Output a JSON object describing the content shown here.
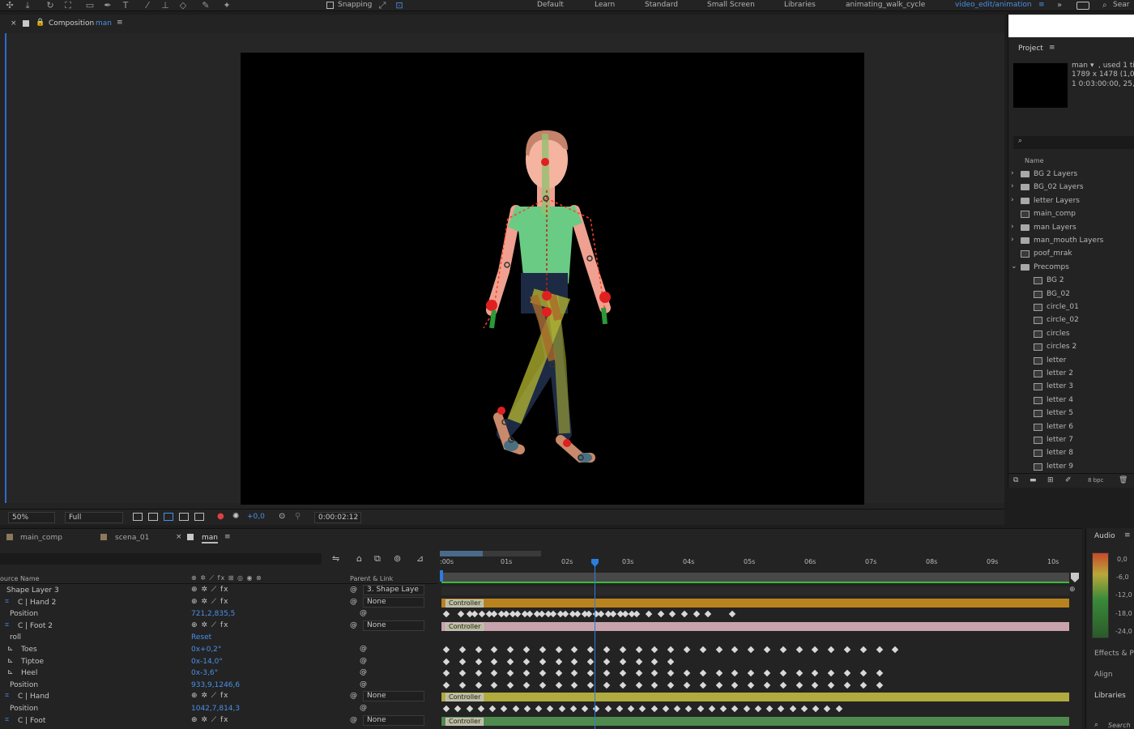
{
  "toolbar": {
    "snapping": "Snapping",
    "workspaces": [
      "Default",
      "Learn",
      "Standard",
      "Small Screen",
      "Libraries",
      "animating_walk_cycle"
    ],
    "active_workspace": "video_edit/animation",
    "search": "Sear"
  },
  "composition": {
    "panel_title": "Composition",
    "comp_name": "man",
    "breadcrumbs": [
      "main_comp",
      "scena_01",
      "man"
    ],
    "zoom": "50%",
    "resolution": "Full",
    "exposure": "+0,0",
    "timecode": "0:00:02:12"
  },
  "project": {
    "title": "Project",
    "thumb_name": "man",
    "thumb_used": ", used 1 ti",
    "thumb_dims": "1789 x 1478 (1,00)",
    "thumb_dur": "1 0:03:00:00, 25,00",
    "col_name": "Name",
    "bpc": "8 bpc",
    "items": [
      {
        "name": "BG 2 Layers",
        "type": "folder",
        "indent": 0,
        "expand": "›"
      },
      {
        "name": "BG_02 Layers",
        "type": "folder",
        "indent": 0,
        "expand": "›"
      },
      {
        "name": "letter Layers",
        "type": "folder",
        "indent": 0,
        "expand": "›"
      },
      {
        "name": "main_comp",
        "type": "comp",
        "indent": 0,
        "expand": ""
      },
      {
        "name": "man Layers",
        "type": "folder",
        "indent": 0,
        "expand": "›"
      },
      {
        "name": "man_mouth Layers",
        "type": "folder",
        "indent": 0,
        "expand": "›"
      },
      {
        "name": "poof_mrak",
        "type": "comp",
        "indent": 0,
        "expand": ""
      },
      {
        "name": "Precomps",
        "type": "folder",
        "indent": 0,
        "expand": "⌄"
      },
      {
        "name": "BG 2",
        "type": "comp",
        "indent": 1,
        "expand": ""
      },
      {
        "name": "BG_02",
        "type": "comp",
        "indent": 1,
        "expand": ""
      },
      {
        "name": "circle_01",
        "type": "comp",
        "indent": 1,
        "expand": ""
      },
      {
        "name": "circle_02",
        "type": "comp",
        "indent": 1,
        "expand": ""
      },
      {
        "name": "circles",
        "type": "comp",
        "indent": 1,
        "expand": ""
      },
      {
        "name": "circles 2",
        "type": "comp",
        "indent": 1,
        "expand": ""
      },
      {
        "name": "letter",
        "type": "comp",
        "indent": 1,
        "expand": ""
      },
      {
        "name": "letter 2",
        "type": "comp",
        "indent": 1,
        "expand": ""
      },
      {
        "name": "letter 3",
        "type": "comp",
        "indent": 1,
        "expand": ""
      },
      {
        "name": "letter 4",
        "type": "comp",
        "indent": 1,
        "expand": ""
      },
      {
        "name": "letter 5",
        "type": "comp",
        "indent": 1,
        "expand": ""
      },
      {
        "name": "letter 6",
        "type": "comp",
        "indent": 1,
        "expand": ""
      },
      {
        "name": "letter 7",
        "type": "comp",
        "indent": 1,
        "expand": ""
      },
      {
        "name": "letter 8",
        "type": "comp",
        "indent": 1,
        "expand": ""
      },
      {
        "name": "letter 9",
        "type": "comp",
        "indent": 1,
        "expand": ""
      }
    ]
  },
  "timeline": {
    "tabs": [
      "main_comp",
      "scena_01",
      "man"
    ],
    "col_source": "ource Name",
    "col_parent": "Parent & Link",
    "ruler": [
      ":00s",
      "01s",
      "02s",
      "03s",
      "04s",
      "05s",
      "06s",
      "07s",
      "08s",
      "09s",
      "10s"
    ],
    "controller_label": "Controller",
    "layers": [
      {
        "name": "Shape Layer 3",
        "value": "",
        "parent": "3. Shape Laye",
        "kind": "layer",
        "icon": false
      },
      {
        "name": "C | Hand 2",
        "value": "",
        "parent": "None",
        "kind": "layer",
        "icon": true
      },
      {
        "name": "Position",
        "value": "721,2,835,5",
        "parent": "",
        "kind": "prop",
        "icon": false
      },
      {
        "name": "C | Foot 2",
        "value": "",
        "parent": "None",
        "kind": "layer",
        "icon": true
      },
      {
        "name": "roll",
        "value": "Reset",
        "parent": "",
        "kind": "prop",
        "icon": false
      },
      {
        "name": "Toes",
        "value": "0x+0,2°",
        "parent": "",
        "kind": "sub",
        "icon": false
      },
      {
        "name": "Tiptoe",
        "value": "0x-14,0°",
        "parent": "",
        "kind": "sub",
        "icon": false
      },
      {
        "name": "Heel",
        "value": "0x-3,6°",
        "parent": "",
        "kind": "sub",
        "icon": false
      },
      {
        "name": "Position",
        "value": "933,9,1246,6",
        "parent": "",
        "kind": "prop",
        "icon": false
      },
      {
        "name": "C | Hand",
        "value": "",
        "parent": "None",
        "kind": "layer",
        "icon": true
      },
      {
        "name": "Position",
        "value": "1042,7,814,3",
        "parent": "",
        "kind": "prop",
        "icon": false
      },
      {
        "name": "C | Foot",
        "value": "",
        "parent": "None",
        "kind": "layer",
        "icon": true
      }
    ]
  },
  "audio": {
    "title": "Audio",
    "levels": [
      "0,0",
      "-6,0",
      "-12,0",
      "-18,0",
      "-24,0"
    ],
    "panels": [
      "Effects & Pr",
      "Align",
      "Libraries"
    ],
    "search": "Search"
  },
  "colors": {
    "accent": "#2d6ad0",
    "hand2_bar": "#b8831e",
    "foot2_bar": "#c8a3ad",
    "hand_bar": "#b1aa3e",
    "foot_bar": "#4f8a4e",
    "playhead": "#2b7de0"
  }
}
